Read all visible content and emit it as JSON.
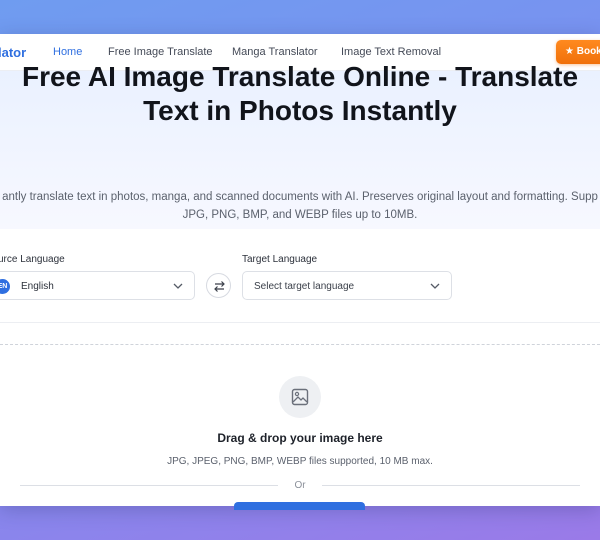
{
  "nav": {
    "brand": "lator",
    "links": [
      "Home",
      "Free Image Translate",
      "Manga Translator",
      "Image Text Removal"
    ],
    "cta": "★ Book"
  },
  "hero": {
    "title_line1": "Free AI Image Translate Online - Translate",
    "title_line2": "Text in Photos Instantly",
    "subtitle_line1": "antly translate text in photos, manga, and scanned documents with AI. Preserves original layout and formatting. Supp",
    "subtitle_line2": "JPG, PNG, BMP, and WEBP files up to 10MB."
  },
  "translator": {
    "source_label": "urce Language",
    "source_badge": "EN",
    "source_value": "English",
    "target_label": "Target Language",
    "target_placeholder": "Select target language"
  },
  "upload": {
    "title": "Drag & drop your image here",
    "formats": "JPG, JPEG, PNG, BMP, WEBP files supported, 10 MB max.",
    "or": "Or"
  },
  "colors": {
    "accent": "#2f6fe0",
    "cta": "#f0700a",
    "backdrop_start": "#6f9cf0",
    "backdrop_end": "#9a7ae8"
  },
  "icons": {
    "swap": "swap-arrows-icon",
    "chevron": "chevron-down-icon",
    "image": "image-icon"
  }
}
